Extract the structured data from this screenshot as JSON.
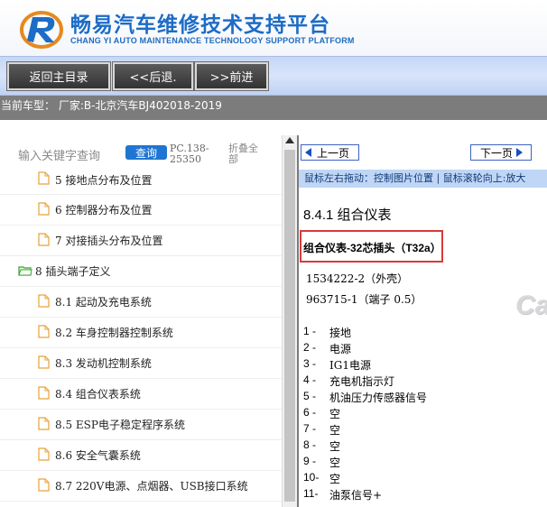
{
  "header": {
    "title": "畅易汽车维修技术支持平台",
    "subtitle": "CHANG YI AUTO MAINTENANCE TECHNOLOGY SUPPORT PLATFORM"
  },
  "nav": {
    "back_label": "返回主目录",
    "prev_label": "<<后退.",
    "next_label": ">>前进"
  },
  "vehicle": {
    "text": "当前车型： 厂家:B-北京汽车BJ402018-2019"
  },
  "search": {
    "placeholder": "输入关键字查询",
    "button_label": "查询",
    "pc_text": "PC.138-25350",
    "collapse_label": "折叠全部"
  },
  "tree": {
    "items": [
      {
        "label": "5 接地点分布及位置"
      },
      {
        "label": "6 控制器分布及位置"
      },
      {
        "label": "7 对接插头分布及位置"
      },
      {
        "label": "8 插头端子定义"
      },
      {
        "label": "8.1 起动及充电系统"
      },
      {
        "label": "8.2 车身控制器控制系统"
      },
      {
        "label": "8.3 发动机控制系统"
      },
      {
        "label": "8.4 组合仪表系统"
      },
      {
        "label": "8.5 ESP电子稳定程序系统"
      },
      {
        "label": "8.6 安全气囊系统"
      },
      {
        "label": "8.7 220V电源、点烟器、USB接口系统"
      }
    ]
  },
  "pager": {
    "prev_label": "上一页",
    "next_label": "下一页",
    "hint": "鼠标左右拖动：控制图片位置 | 鼠标滚轮向上:放大"
  },
  "doc": {
    "section_title": "8.4.1 组合仪表",
    "connector_title": "组合仪表-32芯插头（T32a）",
    "part1": "1534222-2（外壳）",
    "part2": "963715-1（端子 0.5）",
    "watermark": "Ca",
    "pins": [
      {
        "num": "1 -",
        "desc": "接地"
      },
      {
        "num": "2 -",
        "desc": "电源"
      },
      {
        "num": "3 -",
        "desc": "IG1电源"
      },
      {
        "num": "4 -",
        "desc": "充电机指示灯"
      },
      {
        "num": "5 -",
        "desc": "机油压力传感器信号"
      },
      {
        "num": "6 -",
        "desc": "空"
      },
      {
        "num": "7 -",
        "desc": "空"
      },
      {
        "num": "8 -",
        "desc": "空"
      },
      {
        "num": "9 -",
        "desc": "空"
      },
      {
        "num": "10-",
        "desc": "空"
      },
      {
        "num": "11-",
        "desc": "油泵信号+"
      }
    ]
  },
  "colors": {
    "brand_blue": "#1d6cc6",
    "nav_bg": "#c5d7f7",
    "vehicle_bar": "#7c7c7c",
    "search_button": "#1f75d2",
    "highlight_box": "#d83a3a",
    "hint_bar": "#bfd6f5"
  }
}
